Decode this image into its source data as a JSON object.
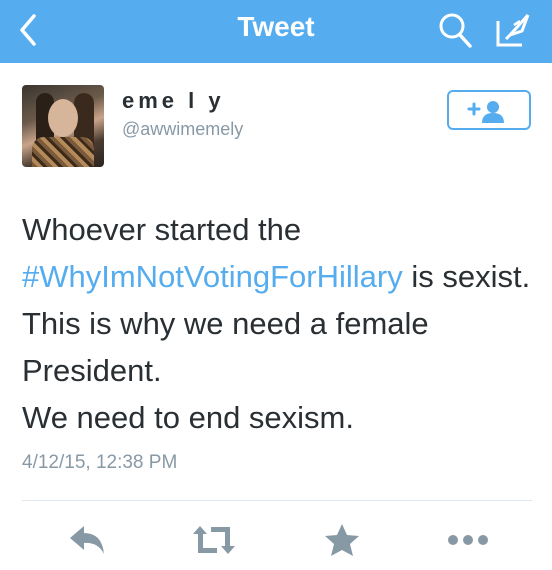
{
  "nav": {
    "title": "Tweet",
    "back_icon": "chevron-left-icon",
    "search_icon": "search-icon",
    "compose_icon": "compose-icon",
    "background_color": "#55acee"
  },
  "tweet": {
    "display_name": "eme l y",
    "handle": "@awwimemely",
    "text_before_hashtag": "Whoever started the ",
    "hashtag": "#WhyImNotVotingForHillary",
    "text_after_hashtag": " is sexist. This is why we need a female President.",
    "text_line_2": "We need to end sexism.",
    "timestamp": "4/12/15, 12:38 PM"
  },
  "follow_button": {
    "icon": "add-user-icon",
    "accent_color": "#55acee"
  },
  "actions": {
    "reply_icon": "reply-icon",
    "retweet_icon": "retweet-icon",
    "favorite_icon": "star-icon",
    "more_icon": "more-icon",
    "icon_color": "#8899a6"
  }
}
